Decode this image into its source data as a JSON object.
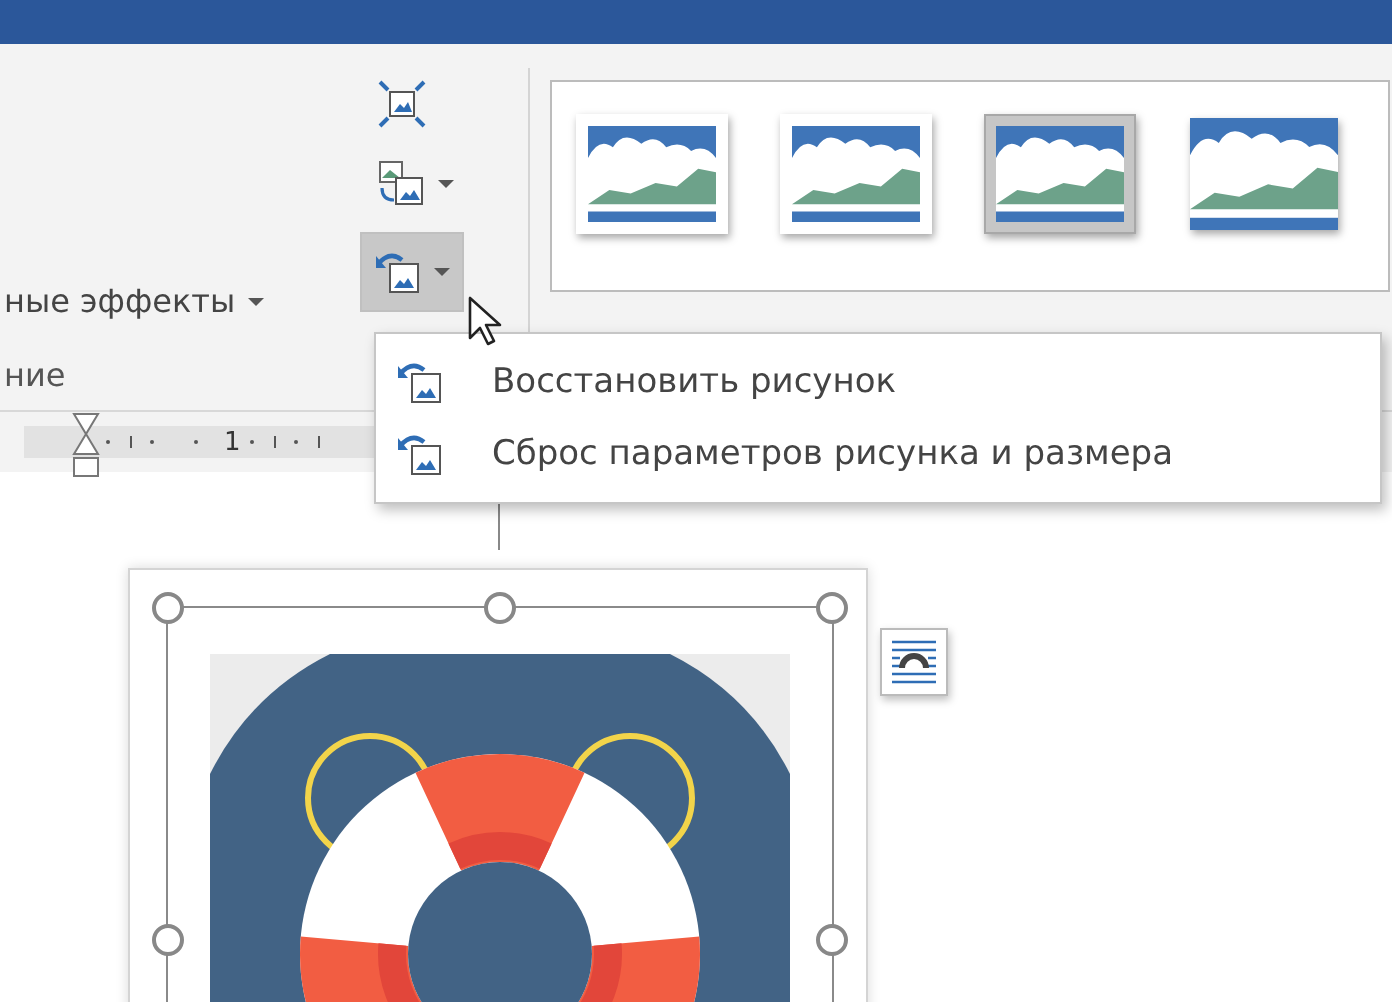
{
  "ribbon": {
    "effects_button": {
      "label": "ные эффекты"
    },
    "group_label": "ние",
    "tools": [
      {
        "kind": "compress",
        "expanded": false
      },
      {
        "kind": "change",
        "expanded": false
      },
      {
        "kind": "reset",
        "expanded": true
      }
    ],
    "styles": [
      {
        "kind": "frame",
        "selected": false
      },
      {
        "kind": "frame",
        "selected": false
      },
      {
        "kind": "frame",
        "selected": true
      },
      {
        "kind": "plain",
        "selected": false
      }
    ]
  },
  "menu": {
    "items": [
      {
        "label": "Восстановить рисунок"
      },
      {
        "label": "Сброс параметров рисунка и размера"
      }
    ]
  },
  "ruler": {
    "label": "1"
  }
}
